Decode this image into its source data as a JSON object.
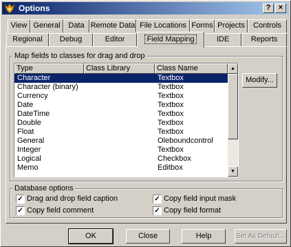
{
  "window": {
    "title": "Options"
  },
  "tabs_row1": [
    "View",
    "General",
    "Data",
    "Remote Data",
    "File Locations",
    "Forms",
    "Projects",
    "Controls"
  ],
  "tabs_row2": [
    "Regional",
    "Debug",
    "Editor",
    "Field Mapping",
    "IDE",
    "Reports"
  ],
  "active_tab": "Field Mapping",
  "map_group": {
    "label": "Map fields to classes for drag and drop",
    "columns": [
      "Type",
      "Class Library",
      "Class Name"
    ],
    "rows": [
      {
        "type": "Character",
        "library": "",
        "class": "Textbox",
        "selected": true
      },
      {
        "type": "Character (binary)",
        "library": "",
        "class": "Textbox"
      },
      {
        "type": "Currency",
        "library": "",
        "class": "Textbox"
      },
      {
        "type": "Date",
        "library": "",
        "class": "Textbox"
      },
      {
        "type": "DateTime",
        "library": "",
        "class": "Textbox"
      },
      {
        "type": "Double",
        "library": "",
        "class": "Textbox"
      },
      {
        "type": "Float",
        "library": "",
        "class": "Textbox"
      },
      {
        "type": "General",
        "library": "",
        "class": "Oleboundcontrol"
      },
      {
        "type": "Integer",
        "library": "",
        "class": "Textbox"
      },
      {
        "type": "Logical",
        "library": "",
        "class": "Checkbox"
      },
      {
        "type": "Memo",
        "library": "",
        "class": "Editbox"
      }
    ],
    "modify_label": "Modify..."
  },
  "db_group": {
    "label": "Database options",
    "options": [
      {
        "label": "Drag and drop field caption",
        "checked": true
      },
      {
        "label": "Copy field input mask",
        "checked": true
      },
      {
        "label": "Copy field comment",
        "checked": true
      },
      {
        "label": "Copy field format",
        "checked": true
      }
    ]
  },
  "buttons": {
    "ok": "OK",
    "close": "Close",
    "help": "Help",
    "set_default": "Set As Default..."
  },
  "icons": {
    "app": "fox-icon",
    "help_caption": "question-icon",
    "close_caption": "close-icon"
  },
  "colors": {
    "title_start": "#0a246a",
    "title_end": "#a6caf0",
    "selection": "#0a246a",
    "face": "#d4d0c8"
  }
}
